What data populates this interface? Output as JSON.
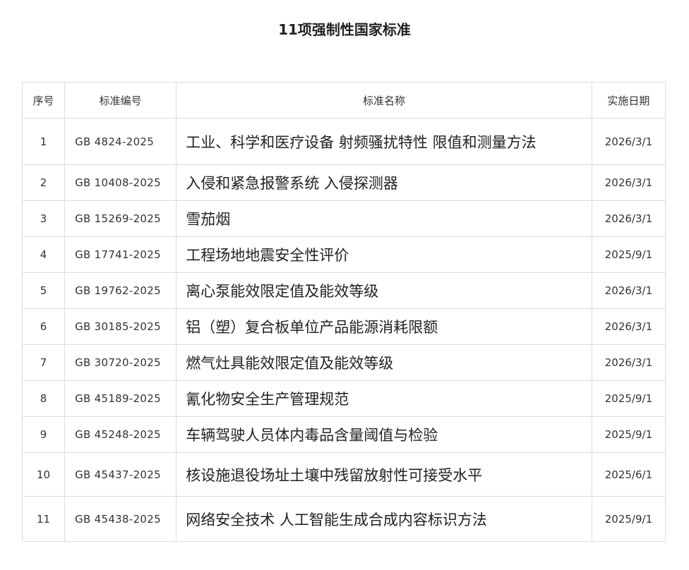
{
  "title": "11项强制性国家标准",
  "table": {
    "headers": {
      "no": "序号",
      "code": "标准编号",
      "name": "标准名称",
      "date": "实施日期"
    },
    "rows": [
      {
        "no": "1",
        "code": "GB 4824-2025",
        "name": "工业、科学和医疗设备 射频骚扰特性 限值和测量方法",
        "date": "2026/3/1"
      },
      {
        "no": "2",
        "code": "GB 10408-2025",
        "name": "入侵和紧急报警系统 入侵探测器",
        "date": "2026/3/1"
      },
      {
        "no": "3",
        "code": "GB 15269-2025",
        "name": "雪茄烟",
        "date": "2026/3/1"
      },
      {
        "no": "4",
        "code": "GB 17741-2025",
        "name": "工程场地地震安全性评价",
        "date": "2025/9/1"
      },
      {
        "no": "5",
        "code": "GB 19762-2025",
        "name": "离心泵能效限定值及能效等级",
        "date": "2026/3/1"
      },
      {
        "no": "6",
        "code": "GB 30185-2025",
        "name": "铝（塑）复合板单位产品能源消耗限额",
        "date": "2026/3/1"
      },
      {
        "no": "7",
        "code": "GB 30720-2025",
        "name": "燃气灶具能效限定值及能效等级",
        "date": "2026/3/1"
      },
      {
        "no": "8",
        "code": "GB 45189-2025",
        "name": "氰化物安全生产管理规范",
        "date": "2025/9/1"
      },
      {
        "no": "9",
        "code": "GB 45248-2025",
        "name": "车辆驾驶人员体内毒品含量阈值与检验",
        "date": "2025/9/1"
      },
      {
        "no": "10",
        "code": "GB 45437-2025",
        "name": "核设施退役场址土壤中残留放射性可接受水平",
        "date": "2025/6/1"
      },
      {
        "no": "11",
        "code": "GB 45438-2025",
        "name": "网络安全技术 人工智能生成合成内容标识方法",
        "date": "2025/9/1"
      }
    ]
  },
  "colors": {
    "text": "#222222",
    "border": "#dcdcdc",
    "background": "#ffffff"
  }
}
